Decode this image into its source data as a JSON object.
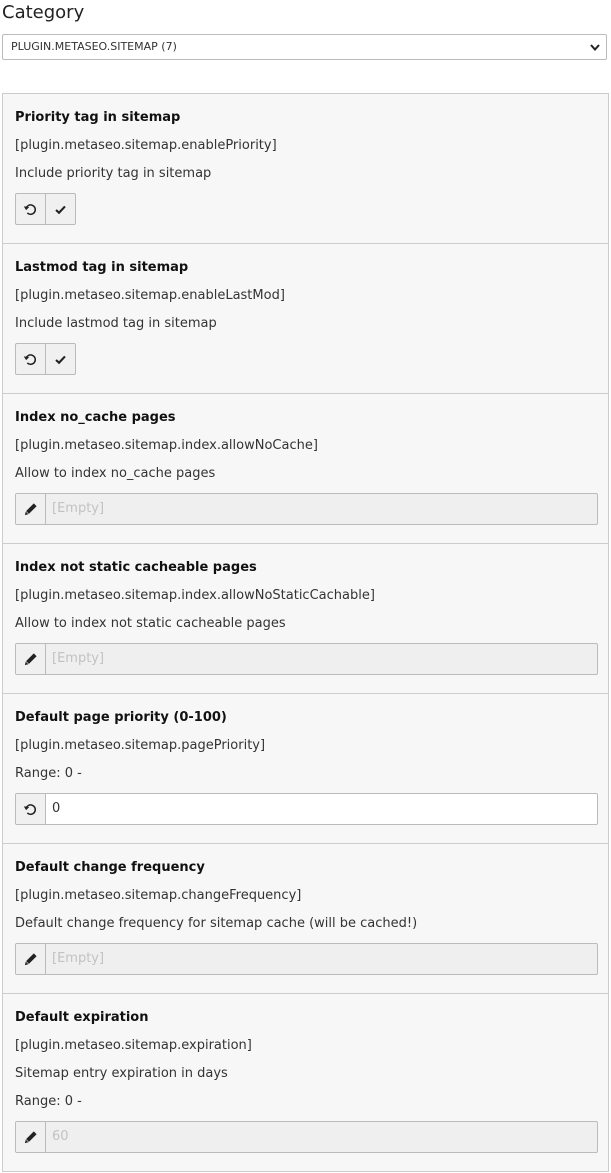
{
  "category": {
    "label": "Category",
    "selected": "PLUGIN.METASEO.SITEMAP (7)"
  },
  "items": [
    {
      "title": "Priority tag in sitemap",
      "key": "[plugin.metaseo.sitemap.enablePriority]",
      "description": "Include priority tag in sitemap",
      "control": {
        "type": "toggle-buttons",
        "icons": [
          "undo-icon",
          "checkmark-icon"
        ]
      }
    },
    {
      "title": "Lastmod tag in sitemap",
      "key": "[plugin.metaseo.sitemap.enableLastMod]",
      "description": "Include lastmod tag in sitemap",
      "control": {
        "type": "toggle-buttons",
        "icons": [
          "undo-icon",
          "checkmark-icon"
        ]
      }
    },
    {
      "title": "Index no_cache pages",
      "key": "[plugin.metaseo.sitemap.index.allowNoCache]",
      "description": "Allow to index no_cache pages",
      "control": {
        "type": "text-field",
        "icon": "pencil-icon",
        "value": "[Empty]"
      }
    },
    {
      "title": "Index not static cacheable pages",
      "key": "[plugin.metaseo.sitemap.index.allowNoStaticCachable]",
      "description": "Allow to index not static cacheable pages",
      "control": {
        "type": "text-field",
        "icon": "pencil-icon",
        "value": "[Empty]"
      }
    },
    {
      "title": "Default page priority (0-100)",
      "key": "[plugin.metaseo.sitemap.pagePriority]",
      "description": "Range: 0 -",
      "control": {
        "type": "text-field",
        "icon": "undo-icon",
        "value": "0"
      }
    },
    {
      "title": "Default change frequency",
      "key": "[plugin.metaseo.sitemap.changeFrequency]",
      "description": "Default change frequency for sitemap cache (will be cached!)",
      "control": {
        "type": "text-field",
        "icon": "pencil-icon",
        "value": "[Empty]"
      }
    },
    {
      "title": "Default expiration",
      "key": "[plugin.metaseo.sitemap.expiration]",
      "description": "Sitemap entry expiration in days",
      "range": "Range: 0 -",
      "control": {
        "type": "text-field",
        "icon": "pencil-icon",
        "value": "60"
      }
    }
  ]
}
